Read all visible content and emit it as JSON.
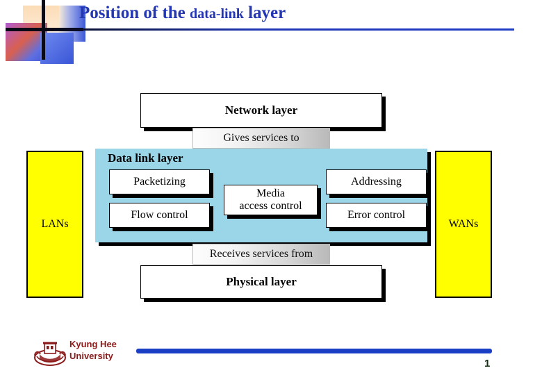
{
  "slide": {
    "title_main": "Position of the ",
    "title_emphasis": "data-link",
    "title_tail": " layer",
    "page_number": "1"
  },
  "footer": {
    "university": "Kyung Hee\nUniversity",
    "logo_icon": "kyung-hee-crest-icon"
  },
  "colors": {
    "title_blue": "#2337b2",
    "rule_blue": "#1f3cc7",
    "data_link_fill": "#9ad5e8",
    "lan_wan_fill": "#ffff00",
    "footer_red": "#8b1a1a",
    "footer_bar_blue": "#1a3fc4",
    "box_border": "#000000",
    "shadow": "#000000"
  },
  "chart_data": {
    "type": "diagram",
    "title": "Position of the data-link layer",
    "description": "Layered protocol stack diagram showing the data link layer positioned between the network layer above and the physical layer below, flanked by LANs and WANs.",
    "nodes": [
      {
        "id": "network-layer",
        "label": "Network layer",
        "role": "upper-layer",
        "fill": "#ffffff"
      },
      {
        "id": "gives-services-to",
        "label": "Gives services to",
        "role": "relation-label",
        "fill": "gradient-white-to-gray"
      },
      {
        "id": "data-link-layer",
        "label": "Data link layer",
        "role": "focus-layer",
        "fill": "#9ad5e8"
      },
      {
        "id": "receives-services-from",
        "label": "Receives services from",
        "role": "relation-label",
        "fill": "gradient-white-to-gray"
      },
      {
        "id": "physical-layer",
        "label": "Physical layer",
        "role": "lower-layer",
        "fill": "#ffffff"
      },
      {
        "id": "lans",
        "label": "LANs",
        "role": "side-context",
        "fill": "#ffff00"
      },
      {
        "id": "wans",
        "label": "WANs",
        "role": "side-context",
        "fill": "#ffff00"
      }
    ],
    "data_link_functions": [
      {
        "id": "packetizing",
        "label": "Packetizing",
        "column": "left",
        "row": 1
      },
      {
        "id": "flow-control",
        "label": "Flow control",
        "column": "left",
        "row": 2
      },
      {
        "id": "media-access-control",
        "label": "Media\naccess control",
        "column": "center",
        "row": 1
      },
      {
        "id": "addressing",
        "label": "Addressing",
        "column": "right",
        "row": 1
      },
      {
        "id": "error-control",
        "label": "Error control",
        "column": "right",
        "row": 2
      }
    ],
    "relations": [
      {
        "from": "data-link-layer",
        "to": "network-layer",
        "label": "Gives services to"
      },
      {
        "from": "physical-layer",
        "to": "data-link-layer",
        "label": "Receives services from"
      }
    ]
  },
  "diagram": {
    "network_layer": "Network layer",
    "gives_services_to": "Gives services to",
    "data_link_layer": "Data link layer",
    "packetizing": "Packetizing",
    "flow_control": "Flow control",
    "media_access_control": "Media\naccess control",
    "addressing": "Addressing",
    "error_control": "Error control",
    "receives_services_from": "Receives services from",
    "physical_layer": "Physical layer",
    "lans": "LANs",
    "wans": "WANs"
  }
}
